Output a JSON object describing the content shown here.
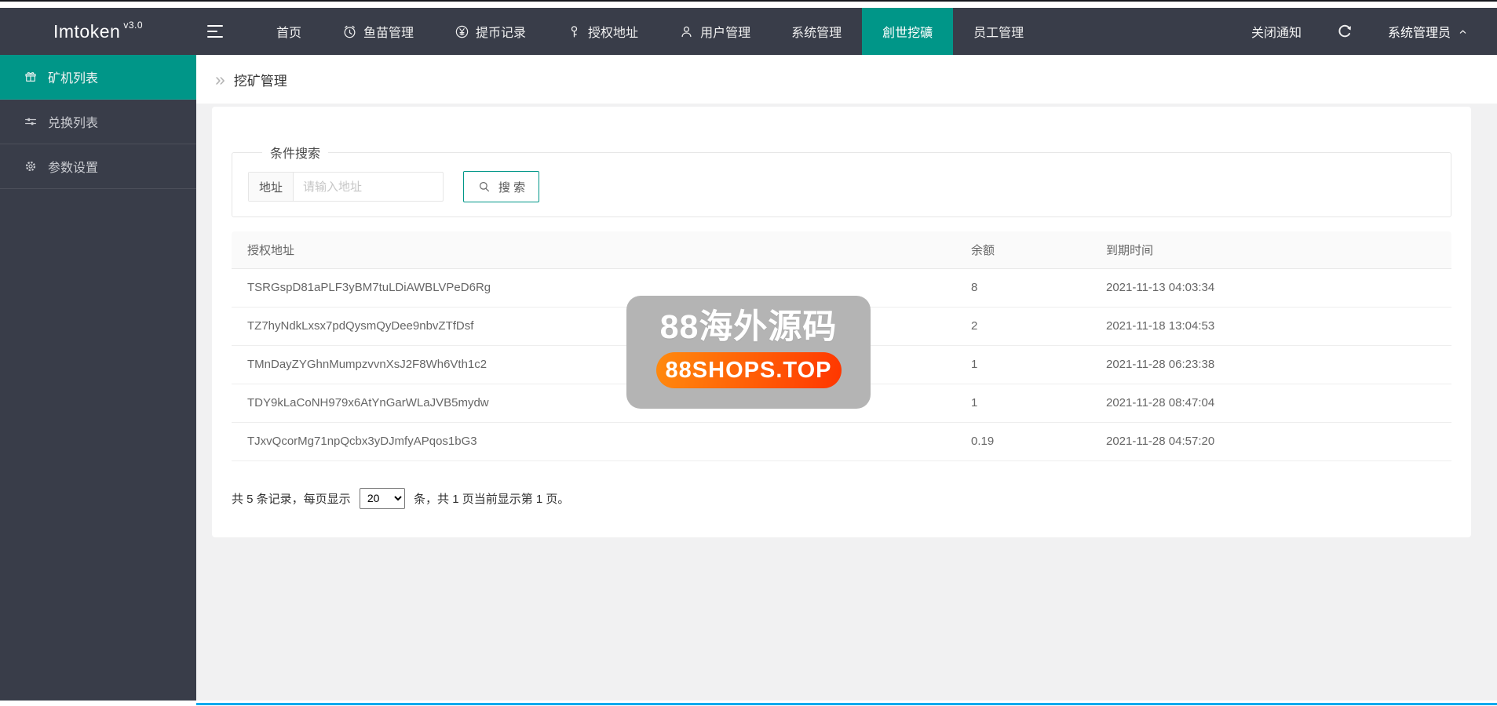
{
  "topbar": {
    "logo": "Imtoken",
    "logo_version": "v3.0",
    "menu": [
      {
        "label": "首页",
        "icon": "none"
      },
      {
        "label": "鱼苗管理",
        "icon": "clock-icon"
      },
      {
        "label": "提币记录",
        "icon": "yen-icon"
      },
      {
        "label": "授权地址",
        "icon": "key-icon"
      },
      {
        "label": "用户管理",
        "icon": "user-icon"
      },
      {
        "label": "系统管理",
        "icon": "none"
      },
      {
        "label": "創世挖礦",
        "icon": "none",
        "active": true
      },
      {
        "label": "员工管理",
        "icon": "none"
      }
    ],
    "close_notice": "关闭通知",
    "username": "系统管理员"
  },
  "sidebar": {
    "items": [
      {
        "label": "矿机列表",
        "icon": "gift-icon",
        "active": true
      },
      {
        "label": "兑换列表",
        "icon": "sliders-icon",
        "active": false
      },
      {
        "label": "参数设置",
        "icon": "gear-icon",
        "active": false
      }
    ]
  },
  "breadcrumb": {
    "separator": "»",
    "title": "挖矿管理"
  },
  "search_panel": {
    "legend": "条件搜索",
    "address_label": "地址",
    "address_placeholder": "请输入地址",
    "address_value": "",
    "search_button": "搜 索"
  },
  "table": {
    "columns": [
      "授权地址",
      "余额",
      "到期时间"
    ],
    "rows": [
      {
        "address": "TSRGspD81aPLF3yBM7tuLDiAWBLVPeD6Rg",
        "balance": "8",
        "expire_time": "2021-11-13 04:03:34"
      },
      {
        "address": "TZ7hyNdkLxsx7pdQysmQyDee9nbvZTfDsf",
        "balance": "2",
        "expire_time": "2021-11-18 13:04:53"
      },
      {
        "address": "TMnDayZYGhnMumpzvvnXsJ2F8Wh6Vth1c2",
        "balance": "1",
        "expire_time": "2021-11-28 06:23:38"
      },
      {
        "address": "TDY9kLaCoNH979x6AtYnGarWLaJVB5mydw",
        "balance": "1",
        "expire_time": "2021-11-28 08:47:04"
      },
      {
        "address": "TJxvQcorMg71npQcbx3yDJmfyAPqos1bG3",
        "balance": "0.19",
        "expire_time": "2021-11-28 04:57:20"
      }
    ]
  },
  "pagination": {
    "text_before": "共 5 条记录，每页显示 ",
    "page_size": "20",
    "text_after": " 条，共 1 页当前显示第 1 页。"
  },
  "watermark": {
    "title": "88海外源码",
    "badge": "88SHOPS.TOP"
  },
  "colors": {
    "accent": "#009688",
    "dark_bg": "#393D49",
    "badge_gradient_start": "#FF8A0E",
    "badge_gradient_end": "#FF3600",
    "bottom_line": "#01AAED",
    "watermark_bg": "#B4B4B4"
  }
}
